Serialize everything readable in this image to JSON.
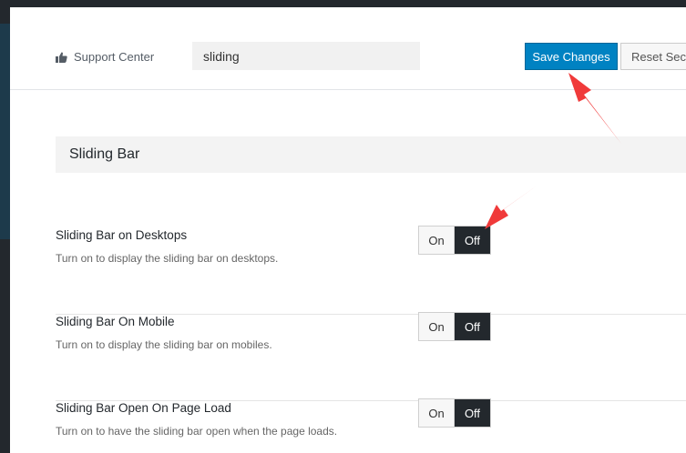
{
  "header": {
    "support_label": "Support Center",
    "search_value": "sliding",
    "save_label": "Save Changes",
    "reset_label": "Reset Section"
  },
  "section": {
    "title": "Sliding Bar"
  },
  "options": [
    {
      "title": "Sliding Bar on Desktops",
      "description": "Turn on to display the sliding bar on desktops.",
      "on_label": "On",
      "off_label": "Off",
      "selected": "Off"
    },
    {
      "title": "Sliding Bar On Mobile",
      "description": "Turn on to display the sliding bar on mobiles.",
      "on_label": "On",
      "off_label": "Off",
      "selected": "Off"
    },
    {
      "title": "Sliding Bar Open On Page Load",
      "description": "Turn on to have the sliding bar open when the page loads.",
      "on_label": "On",
      "off_label": "Off",
      "selected": "Off"
    }
  ],
  "colors": {
    "primary": "#0082c2",
    "toggle_active": "#23282d",
    "annotation": "#f03a3a"
  },
  "icons": {
    "support": "thumbs-up-icon"
  }
}
